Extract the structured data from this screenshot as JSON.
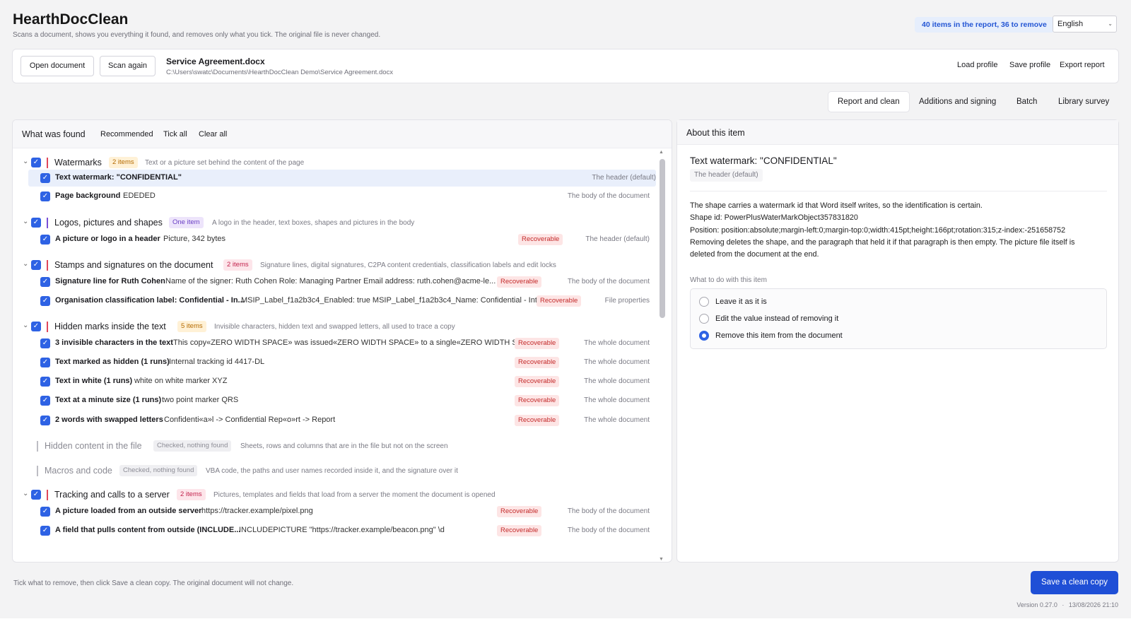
{
  "app": {
    "title": "HearthDocClean",
    "subtitle": "Scans a document, shows you everything it found, and removes only what you tick. The original file is never changed.",
    "summary": "40 items in the report, 36 to remove",
    "language": "English"
  },
  "file": {
    "open_label": "Open document",
    "scan_label": "Scan again",
    "name": "Service Agreement.docx",
    "path": "C:\\Users\\swatc\\Documents\\HearthDocClean Demo\\Service Agreement.docx",
    "load_profile": "Load profile",
    "save_profile": "Save profile",
    "export_report": "Export report"
  },
  "tabs": [
    "Report and clean",
    "Additions and signing",
    "Batch",
    "Library survey"
  ],
  "found": {
    "title": "What was found",
    "recommended": "Recommended",
    "tick_all": "Tick all",
    "clear_all": "Clear all",
    "categories": [
      {
        "name": "Watermarks",
        "badge": "2 items",
        "desc": "Text or a picture set behind the content of the page",
        "items": [
          {
            "name": "Text watermark: \"CONFIDENTIAL\"",
            "value": "",
            "recoverable": "",
            "location": "The header (default)"
          },
          {
            "name": "Page background",
            "value": "EDEDED",
            "recoverable": "",
            "location": "The body of the document"
          }
        ]
      },
      {
        "name": "Logos, pictures and shapes",
        "badge": "One item",
        "desc": "A logo in the header, text boxes, shapes and pictures in the body",
        "items": [
          {
            "name": "A picture or logo in a header",
            "value": "Picture, 342 bytes",
            "recoverable": "Recoverable",
            "location": "The header (default)"
          }
        ]
      },
      {
        "name": "Stamps and signatures on the document",
        "badge": "2 items",
        "desc": "Signature lines, digital signatures, C2PA content credentials, classification labels and edit locks",
        "items": [
          {
            "name": "Signature line for Ruth Cohen",
            "value": "Name of the signer: Ruth Cohen  Role: Managing Partner  Email address: ruth.cohen@acme-le...",
            "recoverable": "Recoverable",
            "location": "The body of the document"
          },
          {
            "name": "Organisation classification label: Confidential - In...",
            "value": "MSIP_Label_f1a2b3c4_Enabled: true  MSIP_Label_f1a2b3c4_Name: Confidential - Inter...",
            "recoverable": "Recoverable",
            "location": "File properties"
          }
        ]
      },
      {
        "name": "Hidden marks inside the text",
        "badge": "5 items",
        "desc": "Invisible characters, hidden text and swapped letters, all used to trace a copy",
        "items": [
          {
            "name": "3 invisible characters in the text",
            "value": "This copy«ZERO WIDTH SPACE» was issued«ZERO WIDTH SPACE» to a single«ZERO WIDTH SPACE...",
            "recoverable": "Recoverable",
            "location": "The whole document"
          },
          {
            "name": "Text marked as hidden (1 runs)",
            "value": "Internal tracking id 4417-DL",
            "recoverable": "Recoverable",
            "location": "The whole document"
          },
          {
            "name": "Text in white (1 runs)",
            "value": "white on white marker XYZ",
            "recoverable": "Recoverable",
            "location": "The whole document"
          },
          {
            "name": "Text at a minute size (1 runs)",
            "value": "two point marker QRS",
            "recoverable": "Recoverable",
            "location": "The whole document"
          },
          {
            "name": "2 words with swapped letters",
            "value": "Confidenti«a»l  ->  Confidential  Rep«o»rt  ->  Report",
            "recoverable": "Recoverable",
            "location": "The whole document"
          }
        ]
      },
      {
        "name": "Hidden content in the file",
        "badge": "Checked, nothing found",
        "desc": "Sheets, rows and columns that are in the file but not on the screen",
        "items": []
      },
      {
        "name": "Macros and code",
        "badge": "Checked, nothing found",
        "desc": "VBA code, the paths and user names recorded inside it, and the signature over it",
        "items": []
      },
      {
        "name": "Tracking and calls to a server",
        "badge": "2 items",
        "desc": "Pictures, templates and fields that load from a server the moment the document is opened",
        "items": [
          {
            "name": "A picture loaded from an outside server",
            "value": "https://tracker.example/pixel.png",
            "recoverable": "Recoverable",
            "location": "The body of the document"
          },
          {
            "name": "A field that pulls content from outside (INCLUDE...",
            "value": "INCLUDEPICTURE \"https://tracker.example/beacon.png\" \\d",
            "recoverable": "Recoverable",
            "location": "The body of the document"
          }
        ]
      }
    ]
  },
  "about": {
    "title": "About this item",
    "item_title": "Text watermark: \"CONFIDENTIAL\"",
    "location": "The header (default)",
    "lines": [
      "The shape carries a watermark id that Word itself writes, so the identification is certain.",
      "Shape id: PowerPlusWaterMarkObject357831820",
      "Position: position:absolute;margin-left:0;margin-top:0;width:415pt;height:166pt;rotation:315;z-index:-251658752",
      "Removing deletes the shape, and the paragraph that held it if that paragraph is then empty. The picture file itself is",
      "deleted from the document at the end."
    ],
    "action_label": "What to do with this item",
    "options": [
      "Leave it as it is",
      "Edit the value instead of removing it",
      "Remove this item from the document"
    ],
    "selected_option": 2
  },
  "footer": {
    "hint": "Tick what to remove, then click Save a clean copy. The original document will not change.",
    "save_label": "Save a clean copy",
    "version": "Version 0.27.0",
    "date": "13/08/2026 21:10"
  },
  "colors": {
    "accent": "#2e62e4",
    "watermarks": "#e0475a",
    "logos": "#7a4fd6",
    "stamps": "#e0475a",
    "hidden_marks": "#e0475a",
    "tracking": "#e0475a",
    "muted": "#bdbdc4"
  }
}
